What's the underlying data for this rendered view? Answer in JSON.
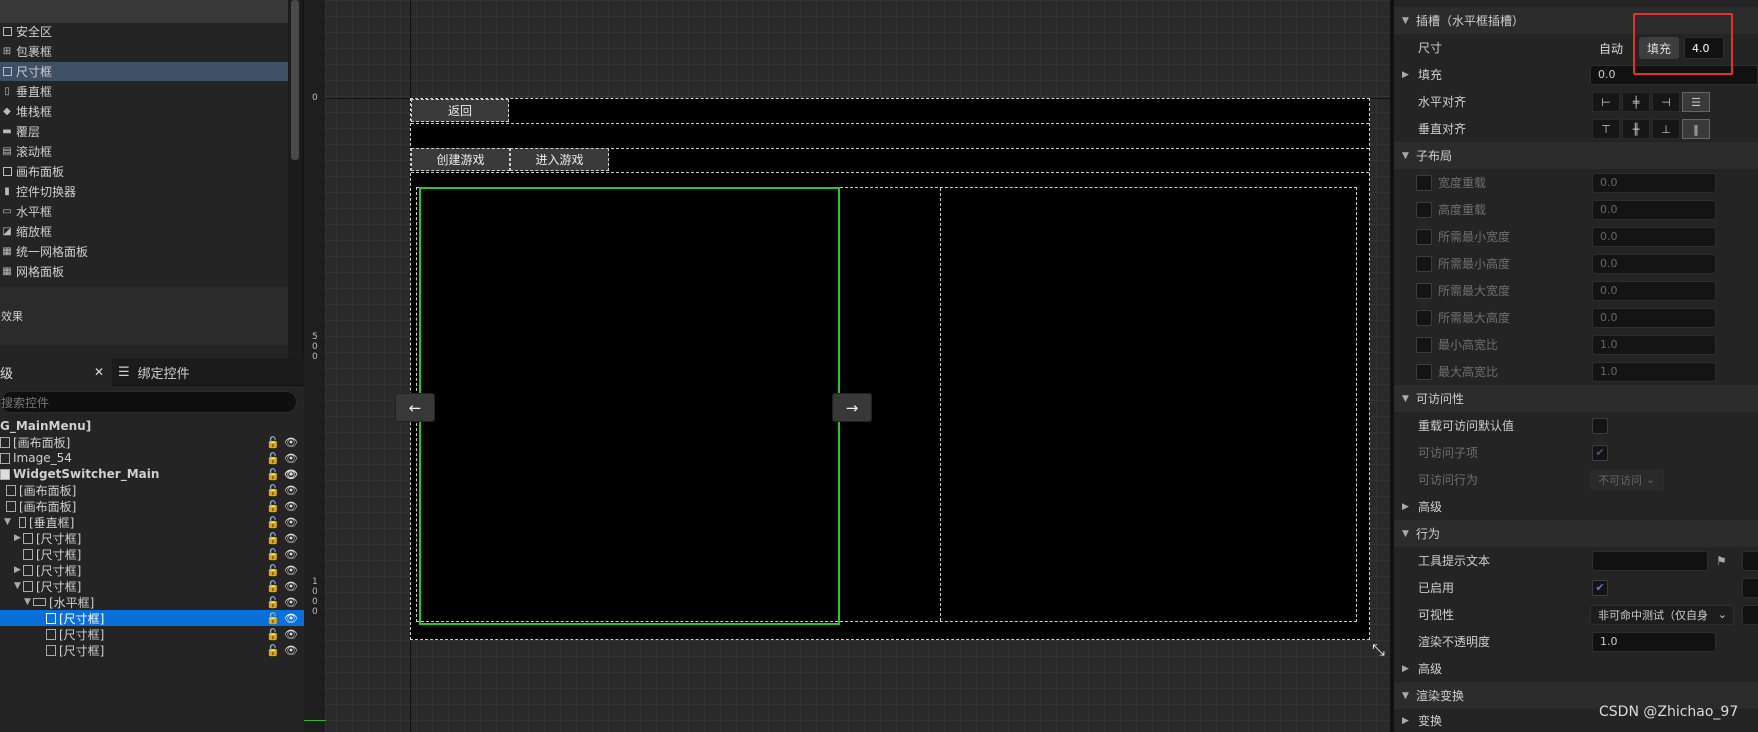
{
  "palette": {
    "items": [
      {
        "label": "安全区",
        "icon": "safe-zone-icon"
      },
      {
        "label": "包裹框",
        "icon": "wrap-box-icon"
      },
      {
        "label": "尺寸框",
        "icon": "size-box-icon",
        "selected": true
      },
      {
        "label": "垂直框",
        "icon": "vertical-box-icon"
      },
      {
        "label": "堆栈框",
        "icon": "stack-box-icon"
      },
      {
        "label": "覆层",
        "icon": "overlay-icon"
      },
      {
        "label": "滚动框",
        "icon": "scroll-box-icon"
      },
      {
        "label": "画布面板",
        "icon": "canvas-panel-icon"
      },
      {
        "label": "控件切换器",
        "icon": "widget-switcher-icon"
      },
      {
        "label": "水平框",
        "icon": "horizontal-box-icon"
      },
      {
        "label": "缩放框",
        "icon": "scale-box-icon"
      },
      {
        "label": "统一网格面板",
        "icon": "uniform-grid-icon"
      },
      {
        "label": "网格面板",
        "icon": "grid-panel-icon"
      }
    ],
    "section": "效果"
  },
  "hierarchy": {
    "tab_label": "级",
    "bind_tab_label": "绑定控件",
    "search_placeholder": "搜索控件",
    "rows": [
      {
        "label": "G_MainMenu]",
        "indent": 0,
        "bold": true
      },
      {
        "label": "[画布面板]",
        "indent": 0
      },
      {
        "label": "Image_54",
        "indent": 0
      },
      {
        "label": "WidgetSwitcher_Main",
        "indent": 0,
        "bold": true
      },
      {
        "label": "[画布面板]",
        "indent": 1
      },
      {
        "label": "[画布面板]",
        "indent": 1
      },
      {
        "label": "[垂直框]",
        "indent": 1,
        "expanded": true
      },
      {
        "label": "[尺寸框]",
        "indent": 2,
        "collapsed": true
      },
      {
        "label": "[尺寸框]",
        "indent": 2
      },
      {
        "label": "[尺寸框]",
        "indent": 2,
        "collapsed": true
      },
      {
        "label": "[尺寸框]",
        "indent": 2,
        "expanded": true
      },
      {
        "label": "[水平框]",
        "indent": 3,
        "expanded": true
      },
      {
        "label": "[尺寸框]",
        "indent": 4,
        "selected": true
      },
      {
        "label": "[尺寸框]",
        "indent": 4
      },
      {
        "label": "[尺寸框]",
        "indent": 4
      }
    ]
  },
  "ruler": {
    "mark_0": "0",
    "mark_500": "500",
    "mark_1000": "1000"
  },
  "canvas": {
    "back_button": "返回",
    "create_game_button": "创建游戏",
    "join_game_button": "进入游戏",
    "left_arrow": "←",
    "right_arrow": "→"
  },
  "details": {
    "slot_header": "插槽（水平框插槽）",
    "size_label": "尺寸",
    "size_auto": "自动",
    "size_fill": "填充",
    "size_value": "4.0",
    "padding_label": "填充",
    "padding_value": "0.0",
    "halign_label": "水平对齐",
    "valign_label": "垂直对齐",
    "child_layout_header": "子布局",
    "child_layout": [
      {
        "label": "宽度重载",
        "value": "0.0"
      },
      {
        "label": "高度重载",
        "value": "0.0"
      },
      {
        "label": "所需最小宽度",
        "value": "0.0"
      },
      {
        "label": "所需最小高度",
        "value": "0.0"
      },
      {
        "label": "所需最大宽度",
        "value": "0.0"
      },
      {
        "label": "所需最大高度",
        "value": "0.0"
      },
      {
        "label": "最小高宽比",
        "value": "1.0"
      },
      {
        "label": "最大高宽比",
        "value": "1.0"
      }
    ],
    "accessibility_header": "可访问性",
    "override_access_label": "重载可访问默认值",
    "access_children_label": "可访问子项",
    "access_behavior_label": "可访问行为",
    "access_behavior_value": "不可访问",
    "advanced_label": "高级",
    "behavior_header": "行为",
    "tooltip_label": "工具提示文本",
    "enabled_label": "已启用",
    "visibility_label": "可视性",
    "visibility_value": "非可命中测试（仅自身",
    "opacity_label": "渲染不透明度",
    "opacity_value": "1.0",
    "advanced2_label": "高级",
    "render_transform_header": "渲染变换",
    "transform_label": "变换"
  },
  "watermark": "CSDN @Zhichao_97",
  "colors": {
    "selection": "#0b6fd9",
    "palette_selected": "#3f4f66",
    "widget_outline": "#22cc22",
    "highlight": "#e6302b",
    "checkbox": "#3d86e0"
  }
}
